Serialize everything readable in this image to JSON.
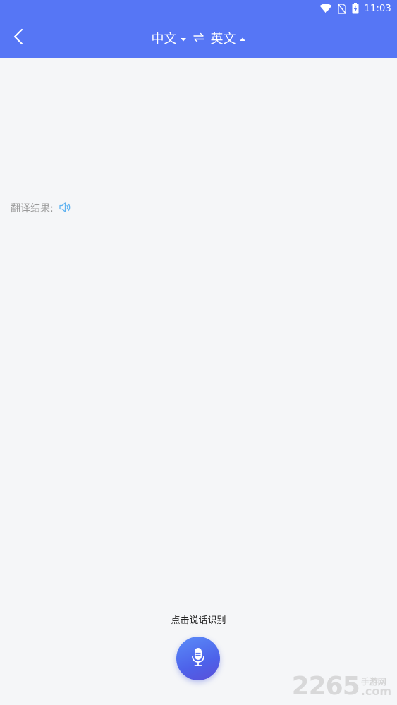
{
  "status_bar": {
    "time": "11:03",
    "icons": [
      "wifi-icon",
      "no-sim-icon",
      "battery-charging-icon"
    ]
  },
  "header": {
    "back_icon": "chevron-left-icon",
    "source_lang": "中文",
    "target_lang": "英文",
    "source_arrow": "triangle-down-icon",
    "target_arrow": "triangle-up-icon",
    "swap_icon": "swap-arrows-icon",
    "background_color": "#5676f5"
  },
  "result": {
    "label": "翻译结果:",
    "speaker_icon": "speaker-icon",
    "speaker_color": "#5fb2f0"
  },
  "bottom": {
    "hint": "点击说话识别",
    "mic_icon": "microphone-icon"
  },
  "watermark": {
    "number": "2265",
    "site_name": "手游网",
    "suffix": ".com"
  }
}
